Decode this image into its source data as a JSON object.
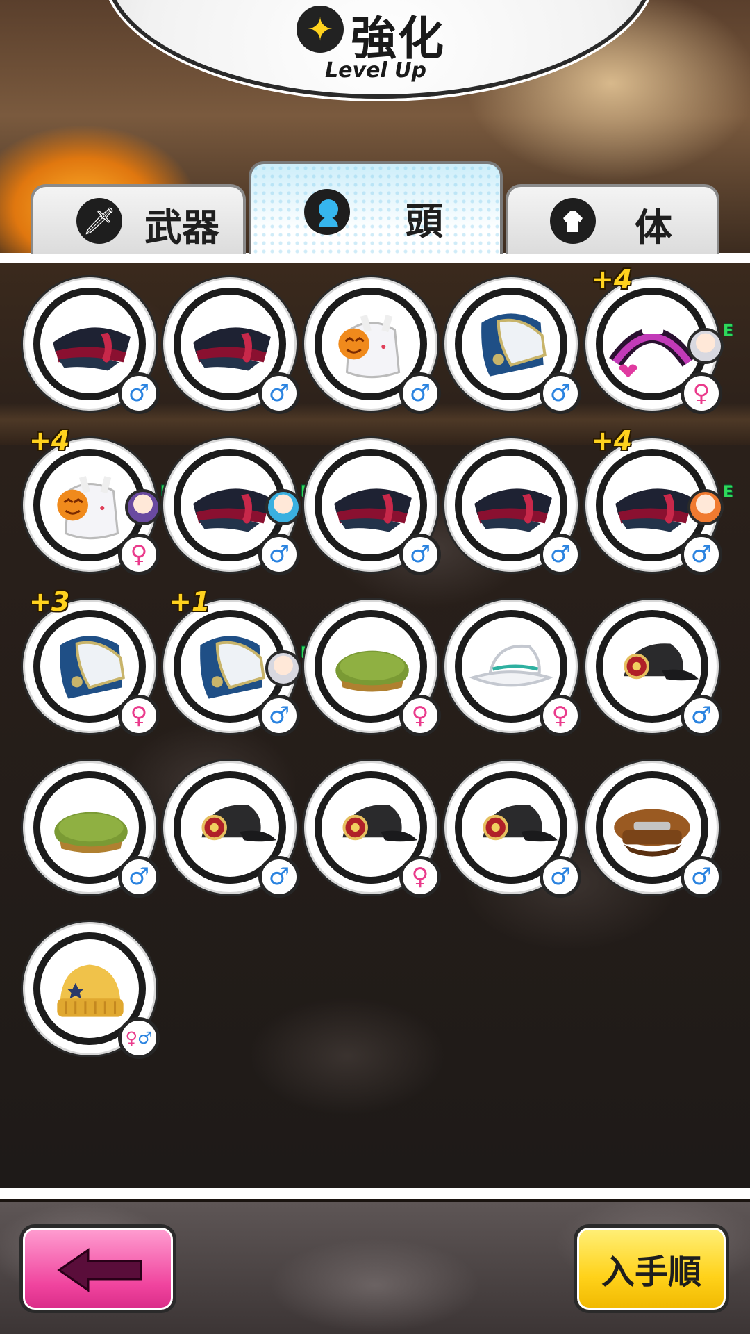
{
  "header": {
    "title": "強化",
    "subtitle": "Level Up",
    "icon": "sparkle-icon"
  },
  "tabs": [
    {
      "label": "武器",
      "icon": "sword-icon",
      "active": false
    },
    {
      "label": "頭",
      "icon": "head-icon",
      "active": true
    },
    {
      "label": "体",
      "icon": "body-icon",
      "active": false
    }
  ],
  "items": [
    {
      "kind": "navy-officer-cap",
      "gender": "♂",
      "plus": "",
      "equipped": false
    },
    {
      "kind": "navy-officer-cap",
      "gender": "♂",
      "plus": "",
      "equipped": false
    },
    {
      "kind": "pumpkin-ghost-hat",
      "gender": "♂",
      "plus": "",
      "equipped": false
    },
    {
      "kind": "blue-helmet",
      "gender": "♂",
      "plus": "",
      "equipped": false
    },
    {
      "kind": "pink-heart-headband",
      "gender": "♀",
      "plus": "+4",
      "equipped": true,
      "equip_mark": "E"
    },
    {
      "kind": "pumpkin-ghost-hat",
      "gender": "♀",
      "plus": "+4",
      "equipped": true,
      "equip_mark": "E"
    },
    {
      "kind": "navy-officer-cap",
      "gender": "♂",
      "plus": "",
      "equipped": true,
      "equip_mark": "E"
    },
    {
      "kind": "navy-officer-cap",
      "gender": "♂",
      "plus": "",
      "equipped": false
    },
    {
      "kind": "navy-officer-cap",
      "gender": "♂",
      "plus": "",
      "equipped": false
    },
    {
      "kind": "navy-officer-cap",
      "gender": "♂",
      "plus": "+4",
      "equipped": true,
      "equip_mark": "E"
    },
    {
      "kind": "blue-helmet",
      "gender": "♀",
      "plus": "+3",
      "equipped": false
    },
    {
      "kind": "blue-helmet",
      "gender": "♂",
      "plus": "+1",
      "equipped": true,
      "equip_mark": "E"
    },
    {
      "kind": "green-beret",
      "gender": "♀",
      "plus": "",
      "equipped": false
    },
    {
      "kind": "white-fedora",
      "gender": "♀",
      "plus": "",
      "equipped": false
    },
    {
      "kind": "black-cap",
      "gender": "♂",
      "plus": "",
      "equipped": false
    },
    {
      "kind": "green-beret",
      "gender": "♂",
      "plus": "",
      "equipped": false
    },
    {
      "kind": "black-cap",
      "gender": "♂",
      "plus": "",
      "equipped": false
    },
    {
      "kind": "black-cap",
      "gender": "♀",
      "plus": "",
      "equipped": false
    },
    {
      "kind": "black-cap",
      "gender": "♂",
      "plus": "",
      "equipped": false
    },
    {
      "kind": "brown-casquette",
      "gender": "♂",
      "plus": "",
      "equipped": false
    },
    {
      "kind": "yellow-knit-beanie",
      "gender": "♀♂",
      "plus": "",
      "equipped": false
    }
  ],
  "footer": {
    "back_icon": "back-arrow-icon",
    "sort_label": "入手順"
  },
  "colors": {
    "male": "#2a83e0",
    "female": "#ea3b8c",
    "plus": "#ffd21e",
    "equip": "#30d85a"
  }
}
